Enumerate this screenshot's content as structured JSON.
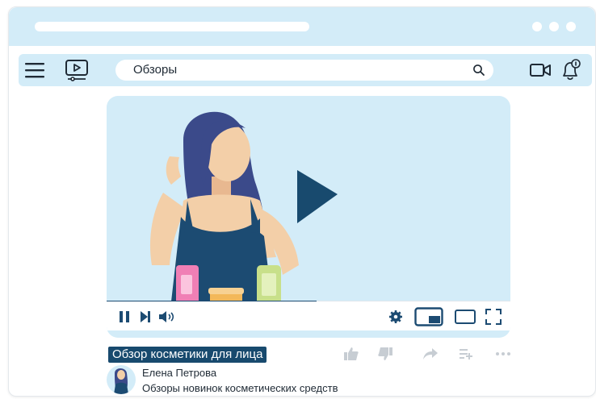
{
  "search": {
    "value": "Обзоры"
  },
  "video": {
    "title": "Обзор косметики для лица",
    "progress": 0.52
  },
  "channel": {
    "name": "Елена Петрова",
    "description": "Обзоры новинок косметических средств"
  },
  "colors": {
    "accent": "#184a6e",
    "panel": "#d3ecf8",
    "icon": "#1c4b72",
    "muted": "#c7cdd3"
  }
}
